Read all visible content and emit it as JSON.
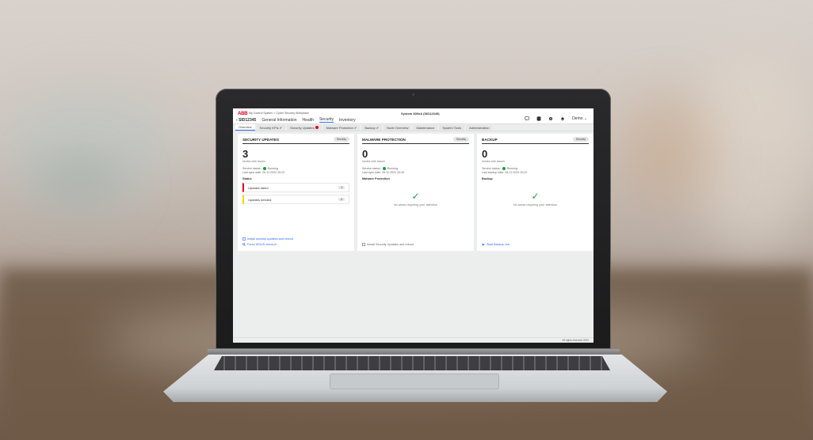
{
  "app": {
    "logo": "ABB",
    "breadcrumb": "My Control System > Cyber Security Workplace",
    "system_title": "System 800xA (SID12345)",
    "nav": {
      "system_id": "SID12345",
      "items": [
        "General Information",
        "Health",
        "Security",
        "Inventory"
      ],
      "active": "Security"
    },
    "user": "Demo"
  },
  "tabs": [
    {
      "label": "Overview",
      "active": true
    },
    {
      "label": "Security KPIs ✔"
    },
    {
      "label": "Security Updates"
    },
    {
      "label": "Malware Protection ✔"
    },
    {
      "label": "Backup ✔"
    },
    {
      "label": "Node Overview"
    },
    {
      "label": "Maintenance"
    },
    {
      "label": "System Tools"
    },
    {
      "label": "Administration"
    }
  ],
  "cards": {
    "security_updates": {
      "title": "SECURITY UPDATES",
      "tag": "Security",
      "count": "3",
      "count_label": "Nodes with issues",
      "service_status_label": "Service status:",
      "service_status": "Running",
      "sync_label": "Last sync date: 26.12.2022 20:22",
      "section": "Status",
      "rows": [
        {
          "label": "Updates failed",
          "count": "1"
        },
        {
          "label": "Updates needed",
          "count": "2"
        }
      ],
      "actions": [
        "Install security updates and reboot",
        "Force WSUS check-in"
      ]
    },
    "malware": {
      "title": "MALWARE PROTECTION",
      "tag": "Security",
      "count": "0",
      "count_label": "Nodes with issues",
      "service_status_label": "Service status:",
      "service_status": "Running",
      "sync_label": "Last sync date: 26.12.2022 20:49",
      "section": "Malware Protection",
      "message": "No areas requiring your attention",
      "action": "Install Security Updates and reboot"
    },
    "backup": {
      "title": "BACKUP",
      "tag": "Security",
      "count": "0",
      "count_label": "Nodes with issues",
      "service_status_label": "Service status:",
      "service_status": "Running",
      "sync_label": "Last backup date: 26.12.2022 20:22",
      "section": "Backup",
      "message": "No areas requiring your attention",
      "action": "Start Backup Job"
    }
  },
  "footer": "All rights reserved 2022",
  "colors": {
    "accent": "#3366ff",
    "brand": "#e2001a",
    "ok": "#1e9b42",
    "warn": "#ffd100"
  }
}
